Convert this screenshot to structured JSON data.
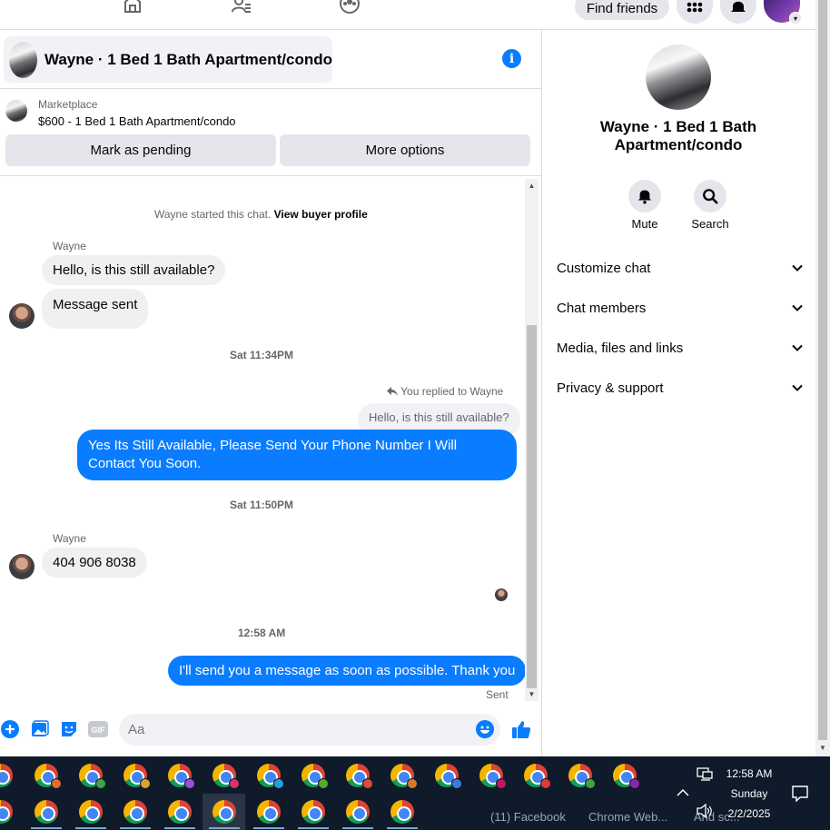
{
  "nav": {
    "find_friends": "Find friends"
  },
  "chat": {
    "title": "Wayne · 1 Bed 1 Bath Apartment/condo",
    "marketplace_label": "Marketplace",
    "listing": "$600 - 1 Bed 1 Bath Apartment/condo",
    "mark_pending": "Mark as pending",
    "more_options": "More options"
  },
  "messages": {
    "started_text": "Wayne started this chat.",
    "view_buyer_profile": "View buyer profile",
    "sender1": "Wayne",
    "msg1": "Hello, is this still available?",
    "msg2": "Message sent",
    "time1": "Sat 11:34PM",
    "reply_label": "You replied to Wayne",
    "reply_quote": "Hello, is this still available?",
    "msg3": "Yes Its Still Available, Please Send Your Phone Number I Will Contact You Soon.",
    "time2": "Sat 11:50PM",
    "sender2": "Wayne",
    "msg4": "404 906 8038",
    "time3": "12:58 AM",
    "msg5": "I'll send you a message as soon as possible. Thank you",
    "sent_status": "Sent"
  },
  "composer": {
    "placeholder": "Aa",
    "icons": [
      "plus-icon",
      "photo-icon",
      "sticker-icon",
      "gif-icon",
      "emoji-icon",
      "like-icon"
    ]
  },
  "right_panel": {
    "name": "Wayne · 1 Bed 1 Bath Apartment/condo",
    "mute": "Mute",
    "search": "Search",
    "rows": [
      "Customize chat",
      "Chat members",
      "Media, files and links",
      "Privacy & support"
    ]
  },
  "taskbar": {
    "label1": "(11) Facebook",
    "label2": "Chrome Web...",
    "label3": "And sc...",
    "time": "12:58 AM",
    "day": "Sunday",
    "date": "2/2/2025"
  },
  "colors": {
    "accent": "#0a7cff",
    "bubble_in": "#f0f0f0",
    "button_bg": "#e4e6eb",
    "taskbar": "#0f1a2a"
  }
}
